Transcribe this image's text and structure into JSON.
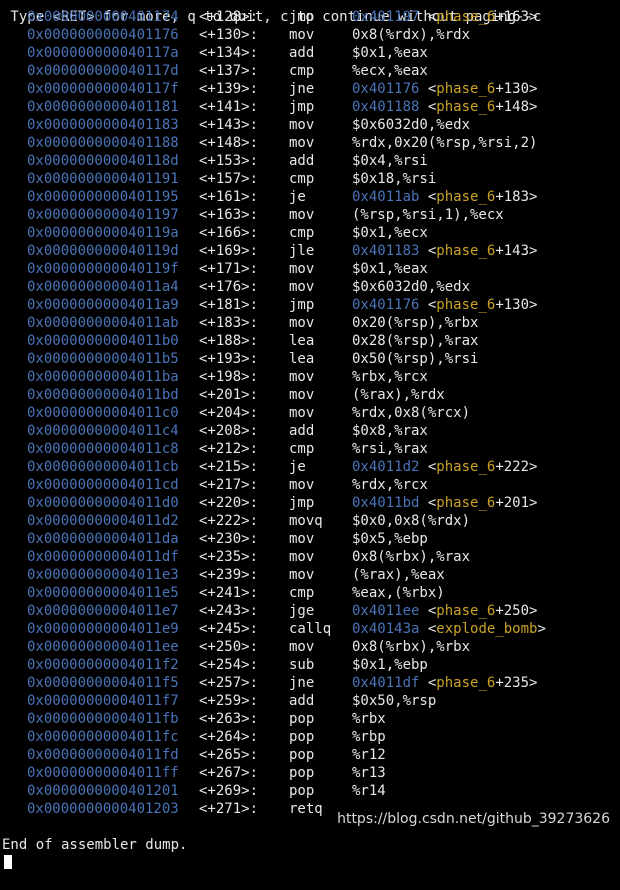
{
  "header_text": " Type <RET> for more, q to quit, c to continue without paging--c",
  "colors": {
    "background": "#000000",
    "text": "#e8e8e8",
    "address": "#4a74b8",
    "symbol": "#c9a227"
  },
  "rows": [
    {
      "addr": "0x0000000000401174",
      "off": "<+128>:",
      "mn": "jmp",
      "op": "",
      "target": "0x401197",
      "sym": "phase_6",
      "off2": "+163>"
    },
    {
      "addr": "0x0000000000401176",
      "off": "<+130>:",
      "mn": "mov",
      "op": "0x8(%rdx),%rdx"
    },
    {
      "addr": "0x000000000040117a",
      "off": "<+134>:",
      "mn": "add",
      "op": "$0x1,%eax"
    },
    {
      "addr": "0x000000000040117d",
      "off": "<+137>:",
      "mn": "cmp",
      "op": "%ecx,%eax"
    },
    {
      "addr": "0x000000000040117f",
      "off": "<+139>:",
      "mn": "jne",
      "target": "0x401176",
      "sym": "phase_6",
      "off2": "+130>"
    },
    {
      "addr": "0x0000000000401181",
      "off": "<+141>:",
      "mn": "jmp",
      "target": "0x401188",
      "sym": "phase_6",
      "off2": "+148>"
    },
    {
      "addr": "0x0000000000401183",
      "off": "<+143>:",
      "mn": "mov",
      "op": "$0x6032d0,%edx"
    },
    {
      "addr": "0x0000000000401188",
      "off": "<+148>:",
      "mn": "mov",
      "op": "%rdx,0x20(%rsp,%rsi,2)"
    },
    {
      "addr": "0x000000000040118d",
      "off": "<+153>:",
      "mn": "add",
      "op": "$0x4,%rsi"
    },
    {
      "addr": "0x0000000000401191",
      "off": "<+157>:",
      "mn": "cmp",
      "op": "$0x18,%rsi"
    },
    {
      "addr": "0x0000000000401195",
      "off": "<+161>:",
      "mn": "je",
      "target": "0x4011ab",
      "sym": "phase_6",
      "off2": "+183>"
    },
    {
      "addr": "0x0000000000401197",
      "off": "<+163>:",
      "mn": "mov",
      "op": "(%rsp,%rsi,1),%ecx"
    },
    {
      "addr": "0x000000000040119a",
      "off": "<+166>:",
      "mn": "cmp",
      "op": "$0x1,%ecx"
    },
    {
      "addr": "0x000000000040119d",
      "off": "<+169>:",
      "mn": "jle",
      "target": "0x401183",
      "sym": "phase_6",
      "off2": "+143>"
    },
    {
      "addr": "0x000000000040119f",
      "off": "<+171>:",
      "mn": "mov",
      "op": "$0x1,%eax"
    },
    {
      "addr": "0x00000000004011a4",
      "off": "<+176>:",
      "mn": "mov",
      "op": "$0x6032d0,%edx"
    },
    {
      "addr": "0x00000000004011a9",
      "off": "<+181>:",
      "mn": "jmp",
      "target": "0x401176",
      "sym": "phase_6",
      "off2": "+130>"
    },
    {
      "addr": "0x00000000004011ab",
      "off": "<+183>:",
      "mn": "mov",
      "op": "0x20(%rsp),%rbx"
    },
    {
      "addr": "0x00000000004011b0",
      "off": "<+188>:",
      "mn": "lea",
      "op": "0x28(%rsp),%rax"
    },
    {
      "addr": "0x00000000004011b5",
      "off": "<+193>:",
      "mn": "lea",
      "op": "0x50(%rsp),%rsi"
    },
    {
      "addr": "0x00000000004011ba",
      "off": "<+198>:",
      "mn": "mov",
      "op": "%rbx,%rcx"
    },
    {
      "addr": "0x00000000004011bd",
      "off": "<+201>:",
      "mn": "mov",
      "op": "(%rax),%rdx"
    },
    {
      "addr": "0x00000000004011c0",
      "off": "<+204>:",
      "mn": "mov",
      "op": "%rdx,0x8(%rcx)"
    },
    {
      "addr": "0x00000000004011c4",
      "off": "<+208>:",
      "mn": "add",
      "op": "$0x8,%rax"
    },
    {
      "addr": "0x00000000004011c8",
      "off": "<+212>:",
      "mn": "cmp",
      "op": "%rsi,%rax"
    },
    {
      "addr": "0x00000000004011cb",
      "off": "<+215>:",
      "mn": "je",
      "target": "0x4011d2",
      "sym": "phase_6",
      "off2": "+222>"
    },
    {
      "addr": "0x00000000004011cd",
      "off": "<+217>:",
      "mn": "mov",
      "op": "%rdx,%rcx"
    },
    {
      "addr": "0x00000000004011d0",
      "off": "<+220>:",
      "mn": "jmp",
      "target": "0x4011bd",
      "sym": "phase_6",
      "off2": "+201>"
    },
    {
      "addr": "0x00000000004011d2",
      "off": "<+222>:",
      "mn": "movq",
      "op": "$0x0,0x8(%rdx)"
    },
    {
      "addr": "0x00000000004011da",
      "off": "<+230>:",
      "mn": "mov",
      "op": "$0x5,%ebp"
    },
    {
      "addr": "0x00000000004011df",
      "off": "<+235>:",
      "mn": "mov",
      "op": "0x8(%rbx),%rax"
    },
    {
      "addr": "0x00000000004011e3",
      "off": "<+239>:",
      "mn": "mov",
      "op": "(%rax),%eax"
    },
    {
      "addr": "0x00000000004011e5",
      "off": "<+241>:",
      "mn": "cmp",
      "op": "%eax,(%rbx)"
    },
    {
      "addr": "0x00000000004011e7",
      "off": "<+243>:",
      "mn": "jge",
      "target": "0x4011ee",
      "sym": "phase_6",
      "off2": "+250>"
    },
    {
      "addr": "0x00000000004011e9",
      "off": "<+245>:",
      "mn": "callq",
      "target": "0x40143a",
      "sym": "explode_bomb",
      "off2": ">"
    },
    {
      "addr": "0x00000000004011ee",
      "off": "<+250>:",
      "mn": "mov",
      "op": "0x8(%rbx),%rbx"
    },
    {
      "addr": "0x00000000004011f2",
      "off": "<+254>:",
      "mn": "sub",
      "op": "$0x1,%ebp"
    },
    {
      "addr": "0x00000000004011f5",
      "off": "<+257>:",
      "mn": "jne",
      "target": "0x4011df",
      "sym": "phase_6",
      "off2": "+235>"
    },
    {
      "addr": "0x00000000004011f7",
      "off": "<+259>:",
      "mn": "add",
      "op": "$0x50,%rsp"
    },
    {
      "addr": "0x00000000004011fb",
      "off": "<+263>:",
      "mn": "pop",
      "op": "%rbx"
    },
    {
      "addr": "0x00000000004011fc",
      "off": "<+264>:",
      "mn": "pop",
      "op": "%rbp"
    },
    {
      "addr": "0x00000000004011fd",
      "off": "<+265>:",
      "mn": "pop",
      "op": "%r12"
    },
    {
      "addr": "0x00000000004011ff",
      "off": "<+267>:",
      "mn": "pop",
      "op": "%r13"
    },
    {
      "addr": "0x0000000000401201",
      "off": "<+269>:",
      "mn": "pop",
      "op": "%r14"
    },
    {
      "addr": "0x0000000000401203",
      "off": "<+271>:",
      "mn": "retq",
      "op": ""
    }
  ],
  "footer_text": "End of assembler dump.",
  "watermark": "https://blog.csdn.net/github_39273626"
}
